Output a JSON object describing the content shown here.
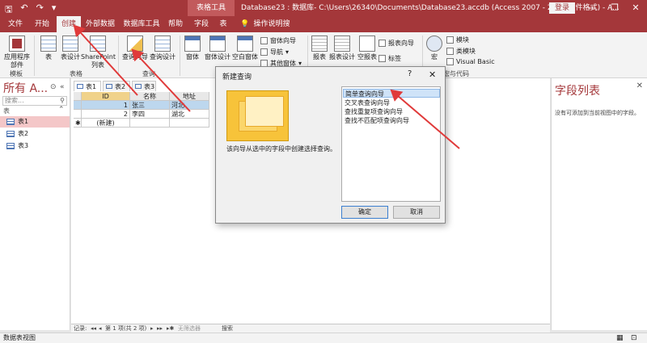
{
  "colors": {
    "accent": "#a4373a",
    "selection": "#cfe3f8",
    "active_nav": "#f4c7c8",
    "arrow": "#e03a3a"
  },
  "titlebar": {
    "quick_access": [
      "save-icon",
      "undo-icon",
      "redo-icon",
      "customize-icon"
    ],
    "tool_tab": "表格工具",
    "document": "Database23 : 数据库- C:\\Users\\26340\\Documents\\Database23.accdb (Access 2007 - 2016 文件格式) - A...",
    "login": "登录",
    "window_buttons": [
      "—",
      "❐",
      "✕"
    ]
  },
  "tabs": [
    "文件",
    "开始",
    "创建",
    "外部数据",
    "数据库工具",
    "帮助",
    "字段",
    "表",
    "操作说明搜索"
  ],
  "ribbon": {
    "templates": {
      "app_parts_1": "应用程序",
      "app_parts_2": "部件",
      "group": "模板"
    },
    "tables": {
      "table": "表",
      "design": "表设计",
      "sharepoint_1": "SharePoint",
      "sharepoint_2": "列表",
      "group": "表格"
    },
    "queries": {
      "wizard": "查询向导",
      "design": "查询设计",
      "group": "查询"
    },
    "forms": {
      "form": "窗体",
      "design": "窗体设计",
      "blank": "空白窗体",
      "wizard": "窗体向导",
      "nav": "导航",
      "more": "其他窗体"
    },
    "reports": {
      "report": "报表",
      "design": "报表设计",
      "blank": "空报表",
      "wizard": "报表向导",
      "label": "标签"
    },
    "macros": {
      "macro": "宏",
      "module": "模块",
      "class_module": "类模块",
      "vb": "Visual Basic",
      "group": "宏与代码"
    }
  },
  "nav": {
    "title": "所有 A...",
    "search_placeholder": "搜索...",
    "section": "表",
    "items": [
      "表1",
      "表2",
      "表3"
    ]
  },
  "doc_tabs": [
    "表1",
    "表2",
    "表3"
  ],
  "grid": {
    "headers": [
      "ID",
      "名称",
      "地址"
    ],
    "rows": [
      {
        "id": "1",
        "name": "张三",
        "addr": "河北"
      },
      {
        "id": "2",
        "name": "李四",
        "addr": "湖北"
      }
    ],
    "new_row": "(新建)"
  },
  "record_bar": {
    "label": "记录:",
    "nav_first": "◂◂",
    "nav_prev": "◂",
    "position": "第 1 项(共 2 项)",
    "nav_next": "▸",
    "nav_last": "▸▸",
    "nav_new": "▸✱",
    "filter": "无筛选器",
    "search": "搜索"
  },
  "field_panel": {
    "title": "字段列表",
    "description": "没有可添加到当前视图中的字段。"
  },
  "status": {
    "view": "数据表视图"
  },
  "dialog": {
    "title": "新建查询",
    "help": "?",
    "close": "✕",
    "description": "该向导从选中的字段中创建选择查询。",
    "options": [
      "简单查询向导",
      "交叉表查询向导",
      "查找重复项查询向导",
      "查找不匹配项查询向导"
    ],
    "ok": "确定",
    "cancel": "取消"
  }
}
